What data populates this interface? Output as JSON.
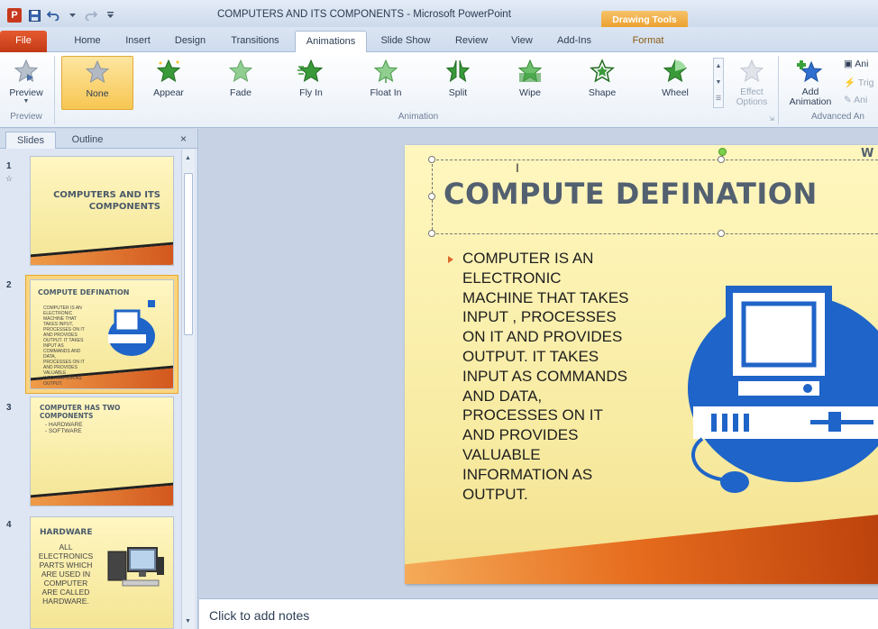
{
  "titlebar": {
    "window_title": "COMPUTERS AND ITS COMPONENTS - Microsoft PowerPoint",
    "context_header": "Drawing Tools",
    "app_logo": "P"
  },
  "tabs": [
    {
      "label": "File"
    },
    {
      "label": "Home"
    },
    {
      "label": "Insert"
    },
    {
      "label": "Design"
    },
    {
      "label": "Transitions"
    },
    {
      "label": "Animations"
    },
    {
      "label": "Slide Show"
    },
    {
      "label": "Review"
    },
    {
      "label": "View"
    },
    {
      "label": "Add-Ins"
    },
    {
      "label": "Format"
    }
  ],
  "ribbon": {
    "preview_label": "Preview",
    "animations": [
      {
        "label": "None",
        "icon": "star-none-icon"
      },
      {
        "label": "Appear",
        "icon": "star-appear-icon"
      },
      {
        "label": "Fade",
        "icon": "star-fade-icon"
      },
      {
        "label": "Fly In",
        "icon": "star-flyin-icon"
      },
      {
        "label": "Float In",
        "icon": "star-floatin-icon"
      },
      {
        "label": "Split",
        "icon": "star-split-icon"
      },
      {
        "label": "Wipe",
        "icon": "star-wipe-icon"
      },
      {
        "label": "Shape",
        "icon": "star-shape-icon"
      },
      {
        "label": "Wheel",
        "icon": "star-wheel-icon"
      }
    ],
    "effect_options": "Effect Options",
    "add_animation_line1": "Add",
    "add_animation_line2": "Animation",
    "animation_pane": "Ani",
    "trigger": "Trig",
    "animation_painter": "Ani",
    "groups": {
      "preview": "Preview",
      "animation": "Animation",
      "advanced": "Advanced An"
    }
  },
  "slide_panel": {
    "tab_slides": "Slides",
    "tab_outline": "Outline",
    "close": "×",
    "thumbs": [
      {
        "num": "1",
        "title": "COMPUTERS AND ITS COMPONENTS"
      },
      {
        "num": "2",
        "title": "COMPUTE DEFINATION",
        "body": "COMPUTER IS AN ELECTRONIC MACHINE THAT TAKES INPUT, PROCESSES ON IT AND PROVIDES OUTPUT. IT TAKES INPUT AS COMMANDS AND DATA, PROCESSES ON IT AND PROVIDES VALUABLE INFORMATION AS OUTPUT."
      },
      {
        "num": "3",
        "title": "COMPUTER HAS TWO COMPONENTS",
        "items": [
          "- HARDWARE",
          "- SOFTWARE"
        ]
      },
      {
        "num": "4",
        "title": "HARDWARE",
        "body": "ALL ELECTRONICS PARTS WHICH ARE USED IN COMPUTER ARE CALLED HARDWARE."
      }
    ]
  },
  "slide": {
    "title": "COMPUTE DEFINATION",
    "corner_text": "W",
    "body_lines": [
      "COMPUTER  IS AN",
      "ELECTRONIC",
      "MACHINE THAT TAKES",
      "INPUT , PROCESSES",
      "ON IT AND  PROVIDES",
      "OUTPUT.  IT TAKES",
      "INPUT AS COMMANDS",
      "AND DATA,",
      "PROCESSES ON IT",
      "AND PROVIDES",
      "VALUABLE",
      "INFORMATION  AS",
      "OUTPUT."
    ]
  },
  "notes": {
    "placeholder": "Click to add notes"
  },
  "colors": {
    "accent_orange": "#e66c1e",
    "computer_blue": "#1f64c8",
    "slide_bg": "#fff7bf"
  }
}
